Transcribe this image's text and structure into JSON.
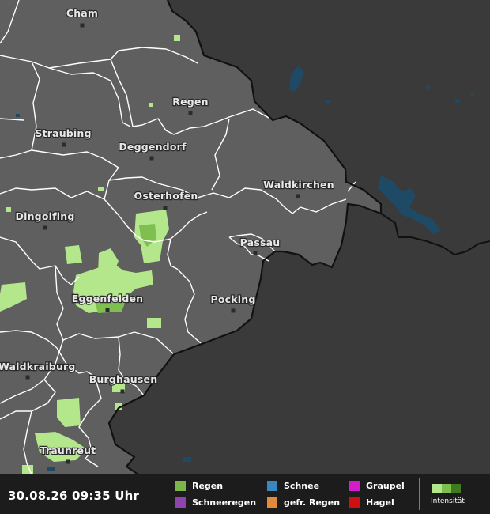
{
  "map": {
    "colors": {
      "inside": "#5f5f5f",
      "outside": "#3a3a3a",
      "border_lines": "#ffffff",
      "national_border": "#111111",
      "water": "#1f4a66",
      "rain_light": "#b4e68c",
      "rain_medium": "#7fbf50"
    },
    "cities": [
      {
        "name": "Cham"
      },
      {
        "name": "Regen"
      },
      {
        "name": "Straubing"
      },
      {
        "name": "Deggendorf"
      },
      {
        "name": "Osterhofen"
      },
      {
        "name": "Waldkirchen"
      },
      {
        "name": "Dingolfing"
      },
      {
        "name": "Passau"
      },
      {
        "name": "Eggenfelden"
      },
      {
        "name": "Pocking"
      },
      {
        "name": "Waldkraiburg"
      },
      {
        "name": "Burghausen"
      },
      {
        "name": "Traunreut"
      }
    ]
  },
  "legend": {
    "timestamp": "30.08.26 09:35 Uhr",
    "items": [
      {
        "label": "Regen",
        "color": "#7ab648"
      },
      {
        "label": "Schneeregen",
        "color": "#8e44ad"
      },
      {
        "label": "Schnee",
        "color": "#3a86c0"
      },
      {
        "label": "gefr. Regen",
        "color": "#e08a3c"
      },
      {
        "label": "Graupel",
        "color": "#d11ec8"
      },
      {
        "label": "Hagel",
        "color": "#d01010"
      }
    ],
    "intensity": {
      "label": "Intensität",
      "colors": [
        "#b4e68c",
        "#7fbf50",
        "#3f7a1e"
      ]
    }
  }
}
